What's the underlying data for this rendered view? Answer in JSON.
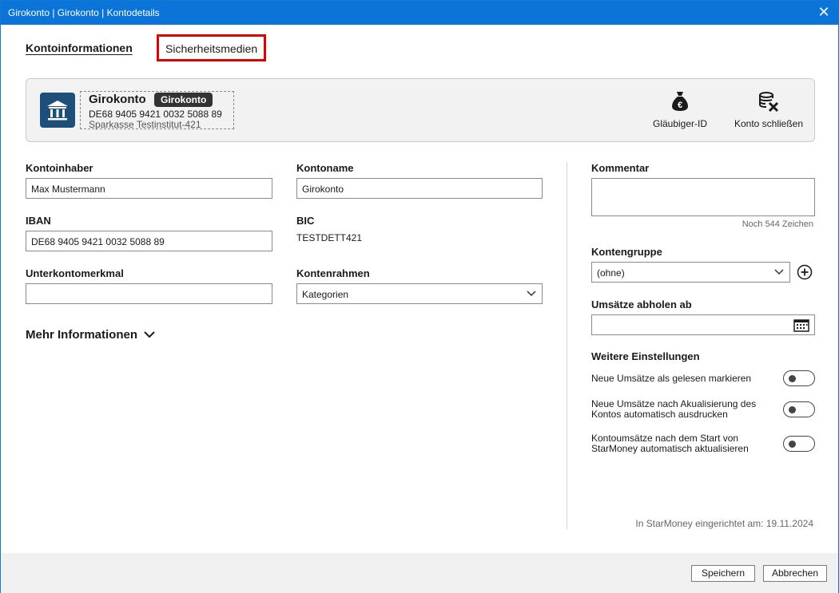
{
  "window": {
    "title": "Girokonto | Girokonto | Kontodetails",
    "close_icon": "close-icon"
  },
  "tabs": [
    {
      "label": "Kontoinformationen",
      "active": true
    },
    {
      "label": "Sicherheitsmedien",
      "active": false
    }
  ],
  "account": {
    "name": "Girokonto",
    "badge": "Girokonto",
    "iban": "DE68 9405 9421 0032 5088 89",
    "bank": "Sparkasse Testinstitut-421",
    "logo_color": "#1d4f7a"
  },
  "card_actions": {
    "creditor_id": "Gläubiger-ID",
    "close_account": "Konto schließen"
  },
  "form": {
    "kontoinhaber_label": "Kontoinhaber",
    "kontoinhaber_value": "Max Mustermann",
    "kontoname_label": "Kontoname",
    "kontoname_value": "Girokonto",
    "iban_label": "IBAN",
    "iban_value": "DE68 9405 9421 0032 5088 89",
    "bic_label": "BIC",
    "bic_value": "TESTDETT421",
    "unterkonto_label": "Unterkontomerkmal",
    "unterkonto_value": "",
    "kontenrahmen_label": "Kontenrahmen",
    "kontenrahmen_value": "Kategorien",
    "more_info": "Mehr Informationen"
  },
  "right": {
    "kommentar_label": "Kommentar",
    "kommentar_value": "",
    "counter": "Noch 544 Zeichen",
    "kontengruppe_label": "Kontengruppe",
    "kontengruppe_value": "(ohne)",
    "umsaetze_label": "Umsätze abholen ab",
    "umsaetze_value": "",
    "weitere_label": "Weitere Einstellungen",
    "toggles": [
      {
        "label": "Neue Umsätze als gelesen markieren",
        "on": false
      },
      {
        "label": "Neue Umsätze nach Akualisierung des Kontos automatisch ausdrucken",
        "on": false
      },
      {
        "label": "Kontoumsätze nach dem Start von StarMoney automatisch aktualisieren",
        "on": false
      }
    ],
    "setup_date": "In StarMoney eingerichtet am: 19.11.2024"
  },
  "footer": {
    "save": "Speichern",
    "cancel": "Abbrechen"
  },
  "colors": {
    "titlebar": "#0a74d9",
    "highlight_border": "#e00000",
    "badge_bg": "#333333"
  }
}
